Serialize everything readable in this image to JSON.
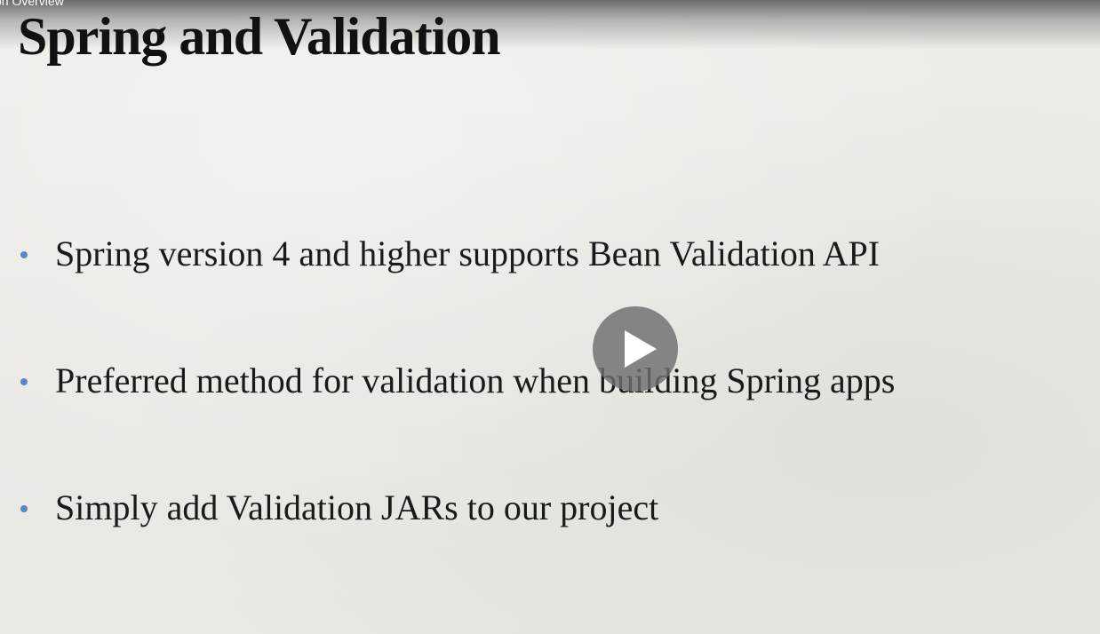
{
  "video": {
    "title_overlay": "on Overview"
  },
  "slide": {
    "title": "Spring and Validation",
    "bullets": [
      {
        "text": "Spring version 4 and higher supports Bean Validation API"
      },
      {
        "text": "Preferred method for validation when building Spring apps"
      },
      {
        "text": "Simply add Validation JARs to our project"
      }
    ]
  },
  "player": {
    "play_icon": "play-icon"
  },
  "colors": {
    "slide_background": "#ecebe6",
    "bullet_accent": "#5b86c4",
    "text": "#1a1a1a",
    "play_button": "#6e6e6e"
  }
}
